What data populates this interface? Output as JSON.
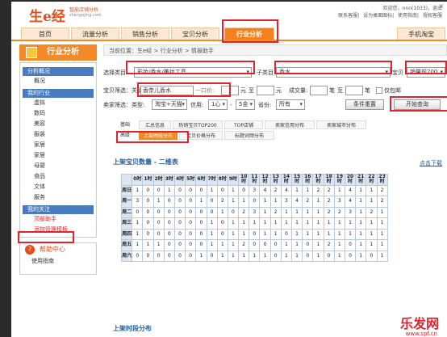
{
  "header": {
    "logo": "生e经",
    "logo_sub": "智能店铺分析",
    "logo_url": "shengejing.com",
    "welcome": "欢迎您，nnn(1033)，退出",
    "links": [
      "联系客服",
      "设为桌面图标",
      "使用指南",
      "授权客服"
    ],
    "close": "×"
  },
  "nav": {
    "tabs": [
      "首页",
      "流量分析",
      "销售分析",
      "宝贝分析",
      "行业分析",
      "手机淘宝"
    ],
    "active": 4
  },
  "sidebar": {
    "title": "行业分析",
    "groups": [
      {
        "label": "分析概况",
        "items": [
          "概况"
        ]
      },
      {
        "label": "我的行业",
        "items": [
          "虚拟",
          "数码",
          "美容",
          "服装",
          "家居",
          "家居",
          "母婴",
          "食品",
          "文体",
          "服务"
        ]
      },
      {
        "label": "我的关注",
        "items": [
          "顶部助手",
          "添加管理模板"
        ]
      }
    ],
    "help_title": "帮助中心",
    "help_item": "使用指南"
  },
  "main": {
    "breadcrumb": "当前位置：生e经 > 行业分析 > 情报助手",
    "filter": {
      "cat_label": "选择类目",
      "cat_value": "彩妆/香水/美妆工具",
      "sub_label": "子类目",
      "sub_value": "香水",
      "baby_label": "宝贝",
      "baby_value": "销量前200",
      "kw_label": "宝贝筛选：关键字",
      "kw_value": "香奈儿香水",
      "price_label": "一口价:",
      "yuan1": "元",
      "to": "至",
      "yuan2": "元",
      "deals_label": "成交量:",
      "bi1": "笔",
      "to2": "至",
      "bi2": "笔",
      "mail_label": "仅包邮",
      "seller_label": "卖家筛选：类型:",
      "seller_type": "淘宝+天猫",
      "credit_label": "信用:",
      "credit_from": "1心",
      "to3": "-",
      "credit_to": "5金",
      "prov_label": "省份:",
      "prov_value": "所有",
      "reset": "条件重置",
      "start": "开始查询"
    },
    "tabs": {
      "row1_label": "基础",
      "row1": [
        "汇总信息",
        "热销宝贝TOP200",
        "TOP店铺",
        "卖家信用分布",
        "卖家城市分布"
      ],
      "row2_label": "高级",
      "row2": [
        "上架时段分布",
        "宝贝价格分布",
        "标题词频分布"
      ],
      "active_row2": 0
    },
    "section1": "上架宝贝数量 - 二维表",
    "download": "点击下载",
    "section2": "上架时段分布"
  },
  "table": {
    "hours": [
      "0时",
      "1时",
      "2时",
      "3时",
      "4时",
      "5时",
      "6时",
      "7时",
      "8时",
      "9时",
      "10时",
      "11时",
      "12时",
      "13时",
      "14时",
      "15时",
      "16时",
      "17时",
      "18时",
      "19时",
      "20时",
      "21时",
      "22时",
      "23时"
    ],
    "rows": [
      {
        "day": "周日",
        "v": [
          "1",
          "0",
          "0",
          "1",
          "0",
          "0",
          "0",
          "1",
          "0",
          "1",
          "0",
          "3",
          "4",
          "2",
          "4",
          "1",
          "1",
          "2",
          "2",
          "1",
          "4",
          "1",
          "1",
          "2"
        ]
      },
      {
        "day": "周一",
        "v": [
          "3",
          "0",
          "1",
          "0",
          "0",
          "0",
          "1",
          "0",
          "2",
          "1",
          "1",
          "0",
          "1",
          "1",
          "3",
          "4",
          "2",
          "1",
          "2",
          "3",
          "4",
          "1",
          "1",
          "2"
        ]
      },
      {
        "day": "周二",
        "v": [
          "0",
          "0",
          "0",
          "0",
          "0",
          "0",
          "0",
          "0",
          "1",
          "0",
          "2",
          "3",
          "1",
          "2",
          "1",
          "1",
          "1",
          "1",
          "2",
          "2",
          "3",
          "1",
          "2",
          "1"
        ]
      },
      {
        "day": "周三",
        "v": [
          "1",
          "0",
          "0",
          "0",
          "0",
          "0",
          "0",
          "1",
          "0",
          "1",
          "1",
          "1",
          "1",
          "1",
          "1",
          "1",
          "1",
          "1",
          "1",
          "1",
          "1",
          "1",
          "1",
          "1"
        ]
      },
      {
        "day": "周四",
        "v": [
          "1",
          "0",
          "0",
          "0",
          "0",
          "0",
          "0",
          "1",
          "0",
          "1",
          "1",
          "0",
          "1",
          "1",
          "0",
          "1",
          "1",
          "1",
          "1",
          "1",
          "1",
          "1",
          "1",
          "1"
        ]
      },
      {
        "day": "周五",
        "v": [
          "1",
          "1",
          "1",
          "0",
          "0",
          "0",
          "0",
          "1",
          "1",
          "1",
          "2",
          "0",
          "0",
          "0",
          "1",
          "1",
          "0",
          "1",
          "2",
          "1",
          "0",
          "1",
          "1",
          "1"
        ]
      },
      {
        "day": "周六",
        "v": [
          "0",
          "0",
          "0",
          "0",
          "0",
          "0",
          "1",
          "0",
          "1",
          "1",
          "1",
          "1",
          "1",
          "0",
          "1",
          "1",
          "0",
          "1",
          "0",
          "1",
          "0",
          "1",
          "0",
          "1"
        ]
      }
    ]
  },
  "watermark": {
    "brand": "乐发网",
    "url": "www.spf.cn"
  }
}
